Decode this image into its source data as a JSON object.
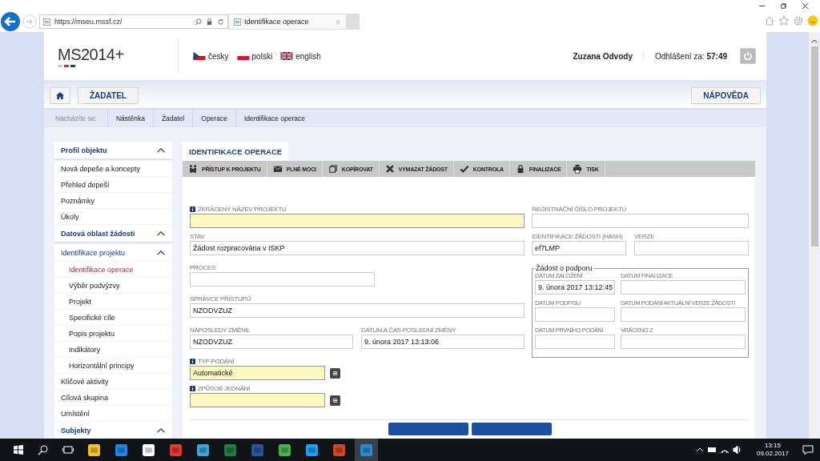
{
  "browser": {
    "address": "https://mseu.mssf.cz/",
    "tab_title": "Identifikace operace"
  },
  "header": {
    "logo": "**MS**2014**+**",
    "languages": [
      {
        "label": "česky"
      },
      {
        "label": "polski"
      },
      {
        "label": "english"
      }
    ],
    "user": "Zuzana Odvody",
    "logout_label": "Odhlášení za:",
    "logout_time": "57:49"
  },
  "nav": {
    "role_button": "ŽADATEL",
    "help_button": "NÁPOVĚDA"
  },
  "breadcrumb": {
    "label": "Nacházíte se:",
    "items": [
      "Nástěnka",
      "Žadatel",
      "Operace",
      "Identifikace operace"
    ]
  },
  "sidebar": [
    {
      "label": "Profil objektu",
      "expanded": true,
      "children": [
        {
          "label": "Nová depeše a koncepty",
          "selected": false
        },
        {
          "label": "Přehled depeší",
          "selected": false
        },
        {
          "label": "Poznámky",
          "selected": false
        },
        {
          "label": "Úkoly",
          "selected": false
        }
      ]
    },
    {
      "label": "Datová oblast žádosti",
      "expanded": true,
      "children": [
        {
          "label": "Identifikace projektu",
          "selected": false,
          "expanded": true,
          "children": [
            {
              "label": "Identifikace operace",
              "selected": true
            },
            {
              "label": "Výběr podvýzvy",
              "selected": false
            },
            {
              "label": "Projekt",
              "selected": false
            },
            {
              "label": "Specifické cíle",
              "selected": false
            },
            {
              "label": "Popis projektu",
              "selected": false
            },
            {
              "label": "Indikátory",
              "selected": false
            },
            {
              "label": "Horizontální principy",
              "selected": false
            }
          ]
        },
        {
          "label": "Klíčové aktivity",
          "selected": false
        },
        {
          "label": "Cílová skupina",
          "selected": false
        },
        {
          "label": "Umístění",
          "selected": false
        }
      ]
    },
    {
      "label": "Subjekty",
      "expanded": true
    }
  ],
  "main_tab": "IDENTIFIKACE OPERACE",
  "toolbar": [
    "PŘÍSTUP K PROJEKTU",
    "PLNÉ MOCI",
    "KOPÍROVAT",
    "VYMAZAT ŽÁDOST",
    "KONTROLA",
    "FINALIZACE",
    "TISK"
  ],
  "form": {
    "left": [
      [
        {
          "label": "ZKRÁCENÝ NÁZEV PROJEKTU",
          "required": true
        }
      ],
      [
        {
          "label": "STAV",
          "value": "Žádost rozpracována v ISKP",
          "required": false
        }
      ],
      [
        {
          "label": "PROCES",
          "required": false
        }
      ],
      [
        {
          "label": "SPRÁVCE PŘÍSTUPŮ",
          "value": "NZODVZUZ",
          "required": false
        }
      ],
      [
        {
          "label": "NAPOSLEDY ZMĚNIL",
          "value": "NZODVZUZ",
          "required": false
        },
        {
          "label": "DATUM A ČAS POSLEDNÍ ZMĚNY",
          "value": "9. února 2017 13:13:06",
          "required": false
        }
      ],
      [
        {
          "label": "TYP PODÁNÍ",
          "value": "Automatické",
          "required": true,
          "picker": true
        }
      ],
      [
        {
          "label": "ZPŮSOB JEDNÁNÍ",
          "required": true,
          "picker": true
        }
      ]
    ],
    "right": [
      [
        {
          "label": "REGISTRAČNÍ ČÍSLO PROJEKTU",
          "required": false
        }
      ],
      [
        {
          "label": "IDENTIFIKACE ŽÁDOSTI (HASH)",
          "value": "ef7LMP",
          "required": false
        },
        {
          "label": "VERZE",
          "required": false
        }
      ]
    ],
    "group": {
      "title": "Žádost o podporu",
      "fields": [
        {
          "label": "DATUM ZALOŽENÍ",
          "value": "9. února 2017 13:12:45"
        },
        {
          "label": "DATUM FINALIZACE"
        },
        {
          "label": "DATUM PODPISU"
        },
        {
          "label": "DATUM PODÁNÍ AKTUÁLNÍ VERZE ŽÁDOSTI"
        },
        {
          "label": "DATUM PRVNÍHO PODÁNÍ"
        },
        {
          "label": "VRÁCENO Z"
        }
      ]
    }
  },
  "taskbar": {
    "time": "13:15",
    "date": "09.02.2017"
  }
}
